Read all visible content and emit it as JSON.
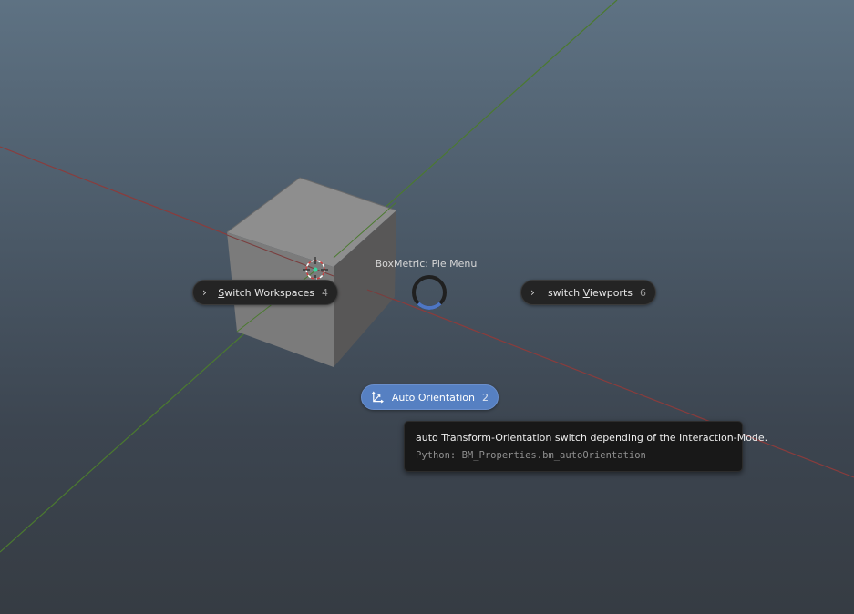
{
  "viewport": {
    "background_top": "#5e7283",
    "background_bottom": "#363c43",
    "axis_x_color": "#8a3c3c",
    "axis_y_color": "#4a7a2e"
  },
  "pie_menu": {
    "title": "BoxMetric: Pie Menu",
    "left": {
      "label_prefix": "",
      "label_mnemonic": "S",
      "label_rest": "witch Workspaces",
      "shortcut": "4",
      "icon": "chevron-right-icon"
    },
    "right": {
      "label_prefix": "switch ",
      "label_mnemonic": "V",
      "label_rest": "iewports",
      "shortcut": "6",
      "icon": "chevron-right-icon"
    },
    "bottom": {
      "label": "Auto Orientation",
      "shortcut": "2",
      "icon": "orientation-axes-icon",
      "active_color": "#5680c2"
    }
  },
  "tooltip": {
    "description": "auto Transform-Orientation switch depending of the Interaction-Mode.",
    "python": "Python: BM_Properties.bm_autoOrientation"
  }
}
